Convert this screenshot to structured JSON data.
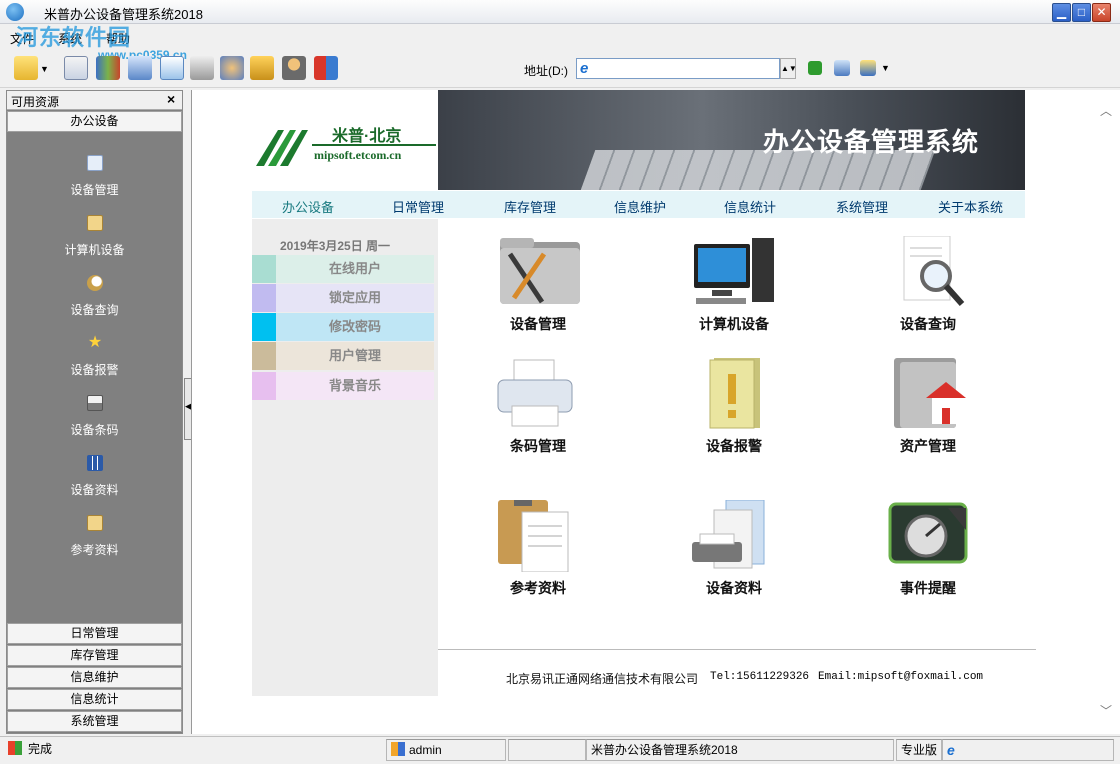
{
  "window": {
    "title": "米普办公设备管理系统2018"
  },
  "watermark": {
    "text": "河东软件园",
    "url": "www.pc0359.cn"
  },
  "menubar": {
    "items": [
      "文件",
      "系统",
      "帮助"
    ]
  },
  "toolbar": {
    "address_label": "地址(D:)",
    "address_value": "",
    "buttons": [
      "open-icon",
      "list-icon",
      "books-icon",
      "report-icon",
      "home-icon",
      "print-icon",
      "users-icon",
      "lock-icon",
      "user-lock-icon",
      "exit-icon"
    ]
  },
  "leftpanel": {
    "title": "可用资源",
    "close_glyph": "×",
    "active_group": "办公设备",
    "items": [
      {
        "label": "设备管理",
        "icon": "document-icon"
      },
      {
        "label": "计算机设备",
        "icon": "clipboard-icon"
      },
      {
        "label": "设备查询",
        "icon": "magnifier-icon"
      },
      {
        "label": "设备报警",
        "icon": "star-icon"
      },
      {
        "label": "设备条码",
        "icon": "printer-icon"
      },
      {
        "label": "设备资料",
        "icon": "grid-icon"
      },
      {
        "label": "参考资料",
        "icon": "clipboard-icon"
      }
    ],
    "groups": [
      "日常管理",
      "库存管理",
      "信息维护",
      "信息统计",
      "系统管理"
    ]
  },
  "banner": {
    "logo_cn": "米普·北京",
    "logo_en": "mipsoft.etcom.cn",
    "title": "办公设备管理系统"
  },
  "nav": {
    "items": [
      "办公设备",
      "日常管理",
      "库存管理",
      "信息维护",
      "信息统计",
      "系统管理",
      "关于本系统"
    ]
  },
  "sidemenu": {
    "date": "2019年3月25日  周一",
    "items": [
      {
        "label": "在线用户",
        "swatch": "#a9ddd2",
        "bg": "#dcefe9"
      },
      {
        "label": "锁定应用",
        "swatch": "#c1bbf0",
        "bg": "#e6e4f6"
      },
      {
        "label": "修改密码",
        "swatch": "#00c0f0",
        "bg": "#bfe6f5"
      },
      {
        "label": "用户管理",
        "swatch": "#cbbb9b",
        "bg": "#ece5da"
      },
      {
        "label": "背景音乐",
        "swatch": "#e7bfef",
        "bg": "#f4e6f6"
      }
    ]
  },
  "tiles": [
    {
      "label": "设备管理",
      "icon": "tools-folder-icon"
    },
    {
      "label": "计算机设备",
      "icon": "computer-icon"
    },
    {
      "label": "设备查询",
      "icon": "search-document-icon"
    },
    {
      "label": "条码管理",
      "icon": "printer-icon"
    },
    {
      "label": "设备报警",
      "icon": "alert-folder-icon"
    },
    {
      "label": "资产管理",
      "icon": "home-folder-icon"
    },
    {
      "label": "参考资料",
      "icon": "clipboard-document-icon"
    },
    {
      "label": "设备资料",
      "icon": "scanner-document-icon"
    },
    {
      "label": "事件提醒",
      "icon": "gauge-icon"
    }
  ],
  "footer": {
    "company": "北京易讯正通网络通信技术有限公司",
    "tel": "Tel:15611229326",
    "email": "Email:mipsoft@foxmail.com"
  },
  "statusbar": {
    "status": "完成",
    "user": "admin",
    "app": "米普办公设备管理系统2018",
    "edition": "专业版"
  }
}
